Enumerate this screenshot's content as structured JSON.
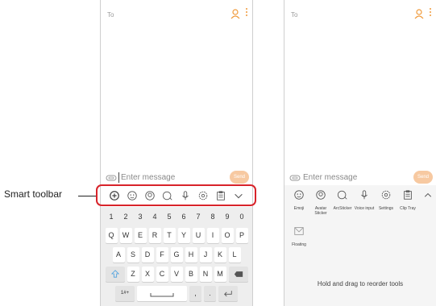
{
  "colors": {
    "accent": "#f09a3a",
    "highlight": "#d8232a",
    "send_bg": "#f7c9a1"
  },
  "callout": {
    "label": "Smart toolbar"
  },
  "left_phone": {
    "to_label": "To",
    "input_placeholder": "Enter message",
    "send_label": "Send",
    "toolbar_icons": [
      "smart-translate-icon",
      "emoji-icon",
      "avatar-sticker-icon",
      "ar-sticker-icon",
      "voice-input-icon",
      "settings-icon",
      "clip-tray-icon",
      "collapse-chevron-icon"
    ],
    "keyboard": {
      "row1": [
        "1",
        "2",
        "3",
        "4",
        "5",
        "6",
        "7",
        "8",
        "9",
        "0"
      ],
      "row2": [
        "Q",
        "W",
        "E",
        "R",
        "T",
        "Y",
        "U",
        "I",
        "O",
        "P"
      ],
      "row3": [
        "A",
        "S",
        "D",
        "F",
        "G",
        "H",
        "J",
        "K",
        "L"
      ],
      "row4": [
        "Z",
        "X",
        "C",
        "V",
        "B",
        "N",
        "M"
      ],
      "symbols_key": "1#+",
      "comma": ",",
      "period": "."
    }
  },
  "right_phone": {
    "to_label": "To",
    "input_placeholder": "Enter message",
    "send_label": "Send",
    "tools": [
      {
        "icon": "emoji-icon",
        "label": "Emoji"
      },
      {
        "icon": "avatar-sticker-icon",
        "label": "Avatar Sticker"
      },
      {
        "icon": "ar-sticker-icon",
        "label": "ArcSticker"
      },
      {
        "icon": "voice-input-icon",
        "label": "Voice input"
      },
      {
        "icon": "settings-icon",
        "label": "Settings"
      },
      {
        "icon": "clip-tray-icon",
        "label": "Clip Tray"
      },
      {
        "icon": "floating-icon",
        "label": "Floating"
      }
    ],
    "hint": "Hold and drag to reorder tools"
  }
}
